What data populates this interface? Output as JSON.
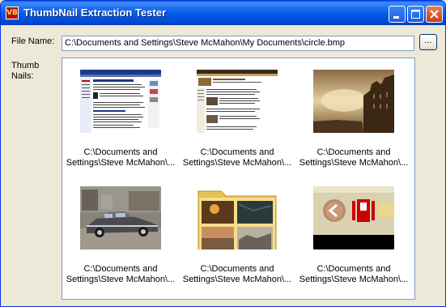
{
  "window": {
    "title": "ThumbNail Extraction Tester",
    "app_icon_text": "VB"
  },
  "form": {
    "file_name_label": "File Name:",
    "file_name_value": "C:\\Documents and Settings\\Steve McMahon\\My Documents\\circle.bmp",
    "browse_label": "...",
    "thumbnails_label_line1": "Thumb",
    "thumbnails_label_line2": "Nails:"
  },
  "thumbnails": [
    {
      "caption1": "C:\\Documents and",
      "caption2": "Settings\\Steve McMahon\\...",
      "kind": "webpage-screenshot"
    },
    {
      "caption1": "C:\\Documents and",
      "caption2": "Settings\\Steve McMahon\\...",
      "kind": "webpage-screenshot"
    },
    {
      "caption1": "C:\\Documents and",
      "caption2": "Settings\\Steve McMahon\\...",
      "kind": "sepia-photo"
    },
    {
      "caption1": "C:\\Documents and",
      "caption2": "Settings\\Steve McMahon\\...",
      "kind": "car-photo"
    },
    {
      "caption1": "C:\\Documents and",
      "caption2": "Settings\\Steve McMahon\\...",
      "kind": "folder-icon"
    },
    {
      "caption1": "C:\\Documents and",
      "caption2": "Settings\\Steve McMahon\\...",
      "kind": "toolbar-crop"
    }
  ],
  "colors": {
    "titlebar": "#0058e6",
    "window_bg": "#ece9d8",
    "field_border": "#7f9db9"
  }
}
